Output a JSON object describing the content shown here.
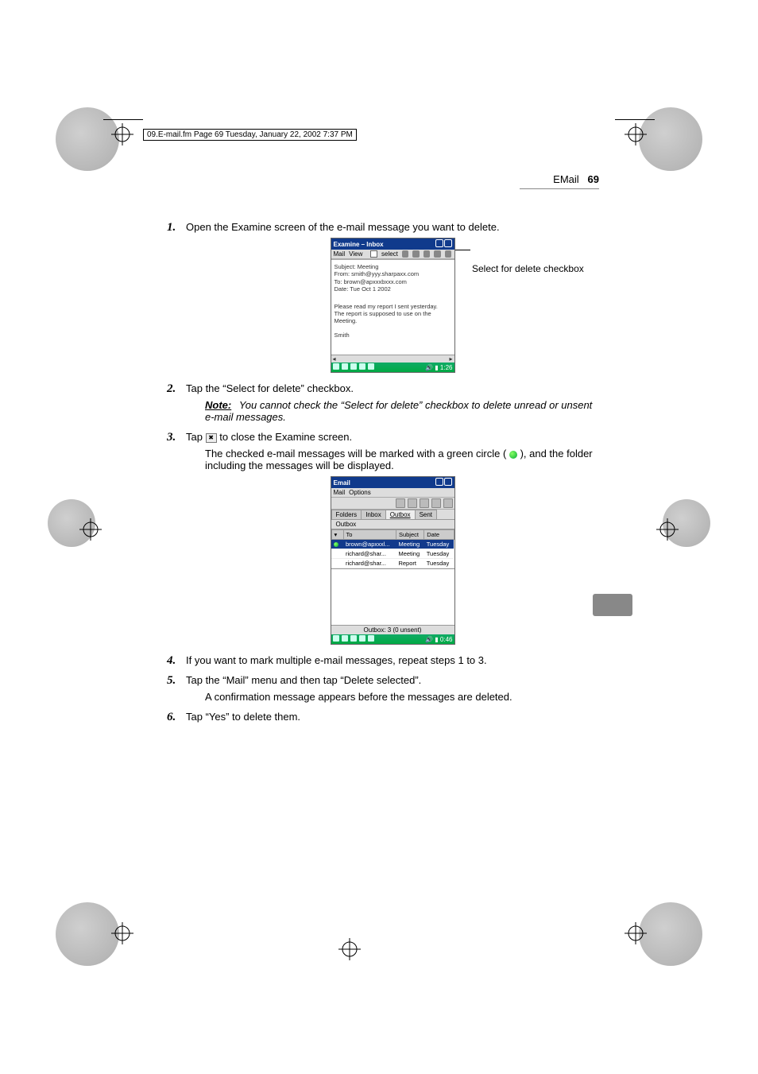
{
  "meta": {
    "frame_header": "09.E-mail.fm  Page 69  Tuesday, January 22, 2002  7:37 PM",
    "section_title": "EMail",
    "page_number": "69"
  },
  "steps": {
    "s1": {
      "num": "1.",
      "text": "Open the Examine screen of the e-mail message you want to delete."
    },
    "s2": {
      "num": "2.",
      "text": "Tap the “Select for delete” checkbox."
    },
    "note": {
      "label": "Note:",
      "text": "You cannot check the “Select for delete” checkbox to delete unread or unsent e-mail messages."
    },
    "s3": {
      "num": "3.",
      "text_a": "Tap ",
      "text_b": " to close the Examine screen.",
      "sub_a": "The checked e-mail messages will be marked with a green circle (",
      "sub_b": "), and the folder including the messages will be displayed."
    },
    "s4": {
      "num": "4.",
      "text": "If you want to mark multiple e-mail messages, repeat steps 1 to 3."
    },
    "s5": {
      "num": "5.",
      "text": "Tap the “Mail” menu and then tap “Delete selected”.",
      "sub": "A confirmation message appears before the messages are deleted."
    },
    "s6": {
      "num": "6.",
      "text": "Tap “Yes” to delete them."
    }
  },
  "callout1": "Select for delete checkbox",
  "fig1": {
    "title": "Examine – Inbox",
    "menu_mail": "Mail",
    "menu_view": "View",
    "select_label": "select",
    "hdr_subject": "Subject: Meeting",
    "hdr_from": "From: smith@yyy.sharpaxx.com",
    "hdr_to": "To: brown@apxxxbxxx.com",
    "hdr_date": "Date: Tue Oct 1 2002",
    "body_line1": "Please read my report I sent yesterday.",
    "body_line2": "The report is supposed to use on the Meeting.",
    "body_sig": "Smith",
    "clock": "1:26"
  },
  "fig2": {
    "title": "Email",
    "menu_mail": "Mail",
    "menu_options": "Options",
    "tab_folders": "Folders",
    "tab_inbox": "Inbox",
    "tab_outbox": "Outbox",
    "tab_sent": "Sent",
    "crumb": "Outbox",
    "col_to": "To",
    "col_subject": "Subject",
    "col_date": "Date",
    "rows": [
      {
        "to": "brown@apxxxl...",
        "subject": "Meeting",
        "date": "Tuesday"
      },
      {
        "to": "richard@shar...",
        "subject": "Meeting",
        "date": "Tuesday"
      },
      {
        "to": "richard@shar...",
        "subject": "Report",
        "date": "Tuesday"
      }
    ],
    "status": "Outbox: 3 (0 unsent)",
    "clock": "0:46"
  },
  "icons": {
    "close_x": "✖",
    "col_chev": "▾"
  }
}
